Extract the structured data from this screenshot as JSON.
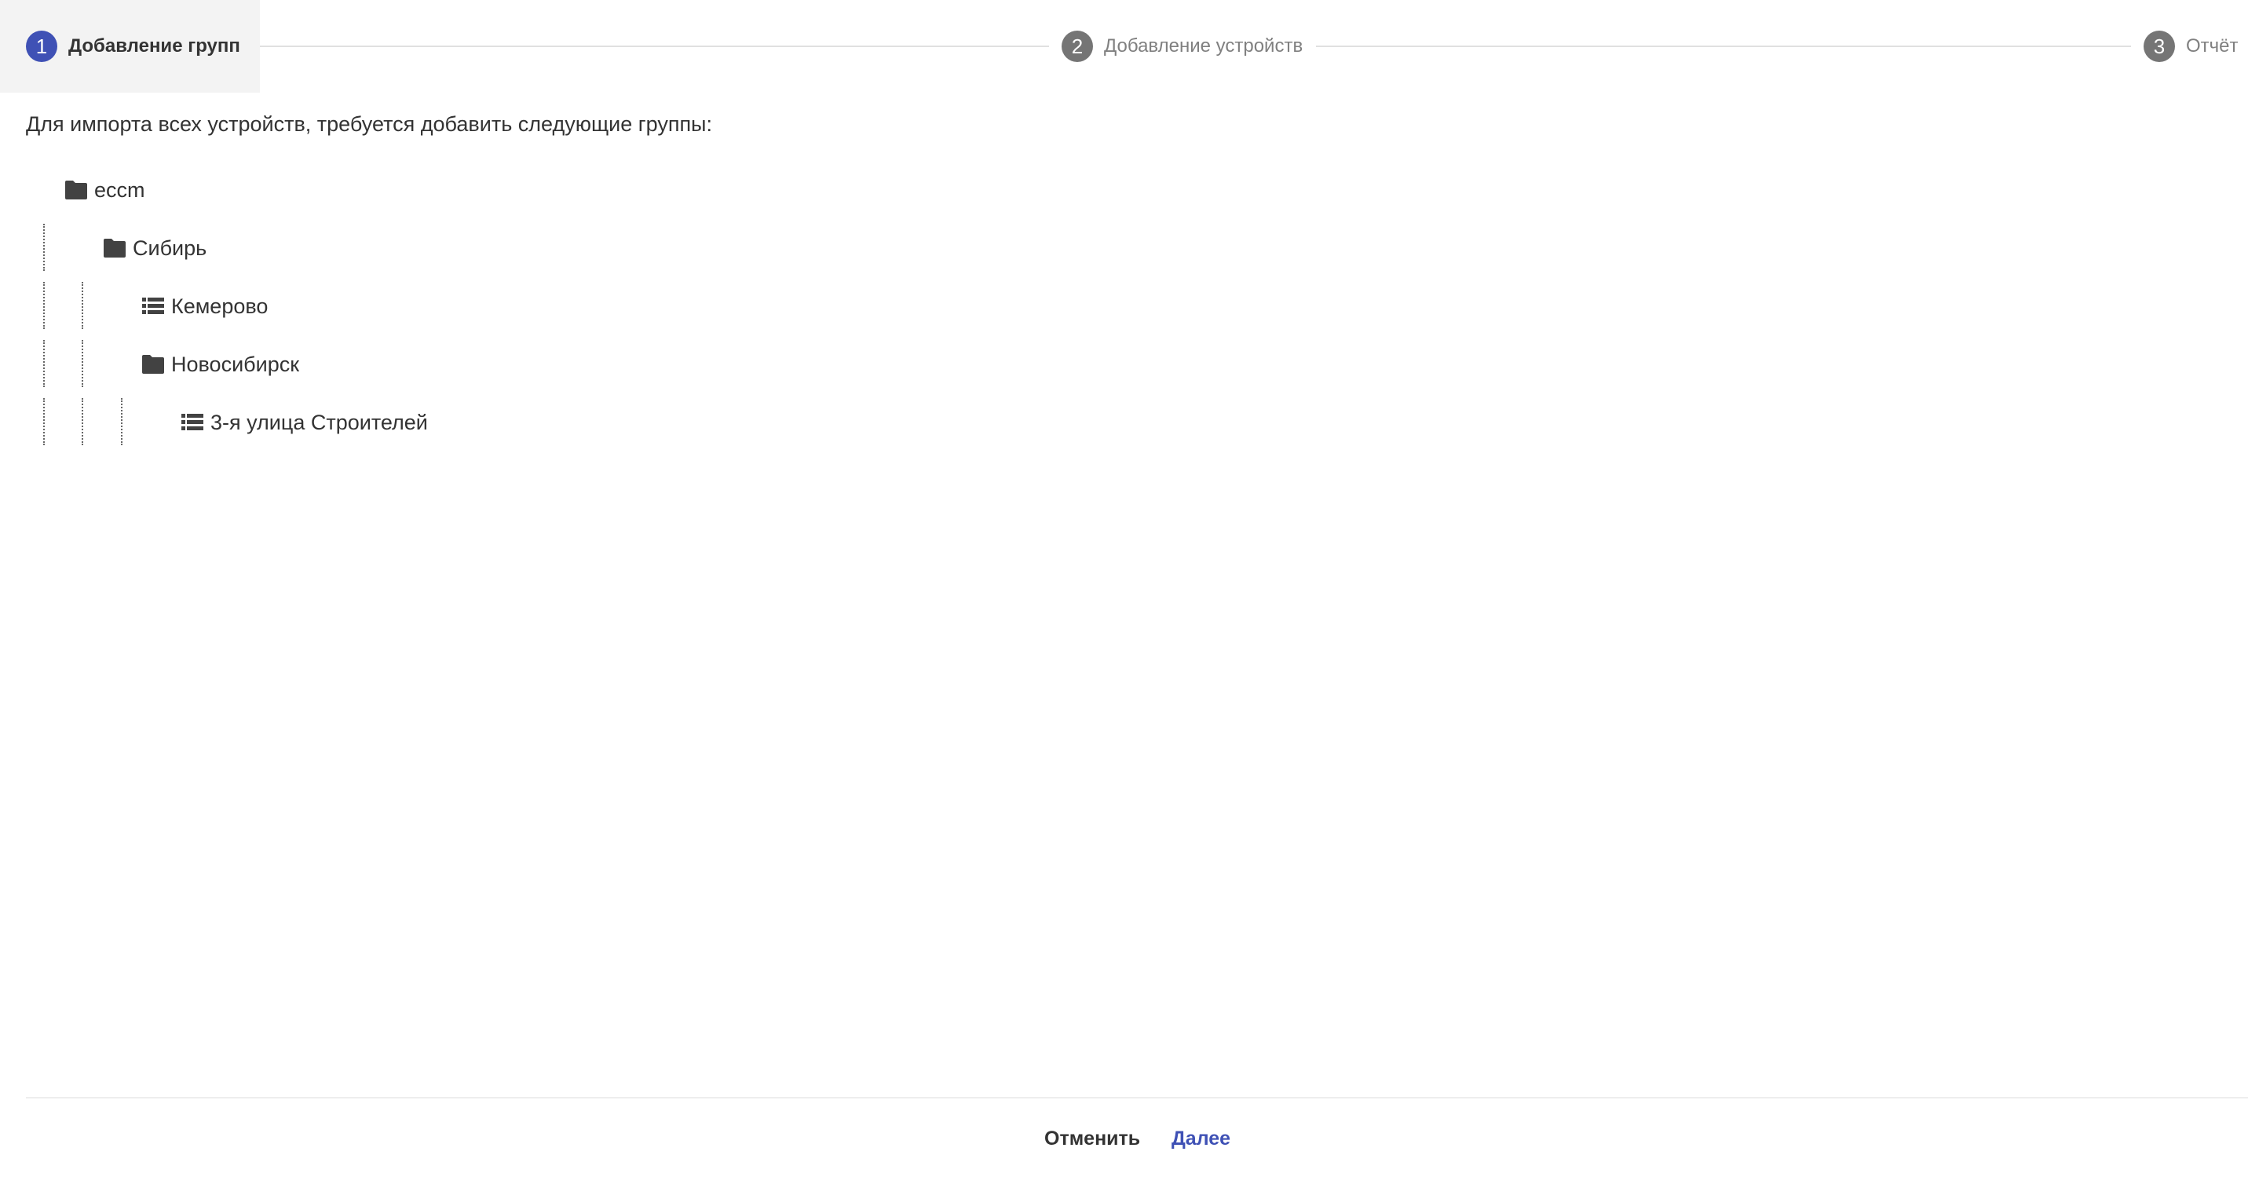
{
  "stepper": {
    "steps": [
      {
        "number": "1",
        "label": "Добавление групп",
        "state": "active"
      },
      {
        "number": "2",
        "label": "Добавление устройств",
        "state": "inactive"
      },
      {
        "number": "3",
        "label": "Отчёт",
        "state": "inactive"
      }
    ]
  },
  "message": "Для импорта всех устройств, требуется добавить следующие группы:",
  "tree": {
    "nodes": [
      {
        "label": "eccm",
        "icon": "folder-icon",
        "depth": 0
      },
      {
        "label": "Сибирь",
        "icon": "folder-icon",
        "depth": 1
      },
      {
        "label": "Кемерово",
        "icon": "list-icon",
        "depth": 2
      },
      {
        "label": "Новосибирск",
        "icon": "folder-icon",
        "depth": 2
      },
      {
        "label": "3-я улица Строителей",
        "icon": "list-icon",
        "depth": 3
      }
    ]
  },
  "footer": {
    "cancel_label": "Отменить",
    "next_label": "Далее"
  },
  "colors": {
    "accent": "#3f51b5",
    "inactive_step": "#757575",
    "active_step_bg": "#f3f3f3",
    "icon": "#424242"
  }
}
